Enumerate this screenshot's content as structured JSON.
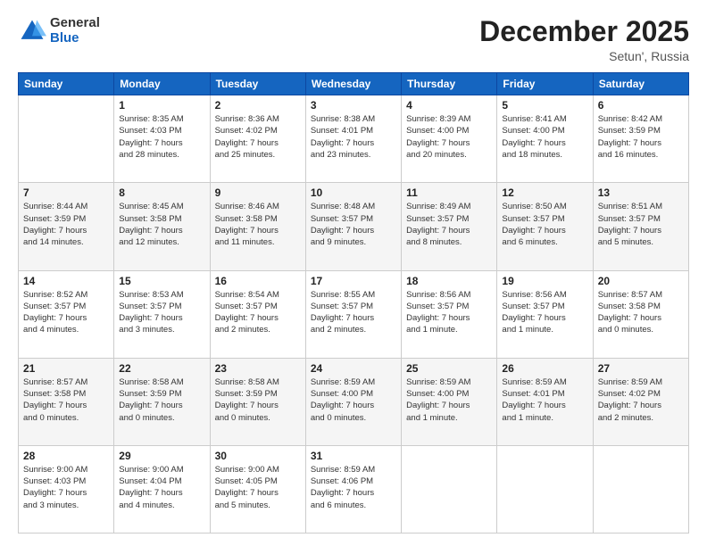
{
  "logo": {
    "general": "General",
    "blue": "Blue"
  },
  "title": "December 2025",
  "subtitle": "Setun', Russia",
  "days": [
    "Sunday",
    "Monday",
    "Tuesday",
    "Wednesday",
    "Thursday",
    "Friday",
    "Saturday"
  ],
  "weeks": [
    [
      {
        "date": "",
        "info": ""
      },
      {
        "date": "1",
        "info": "Sunrise: 8:35 AM\nSunset: 4:03 PM\nDaylight: 7 hours\nand 28 minutes."
      },
      {
        "date": "2",
        "info": "Sunrise: 8:36 AM\nSunset: 4:02 PM\nDaylight: 7 hours\nand 25 minutes."
      },
      {
        "date": "3",
        "info": "Sunrise: 8:38 AM\nSunset: 4:01 PM\nDaylight: 7 hours\nand 23 minutes."
      },
      {
        "date": "4",
        "info": "Sunrise: 8:39 AM\nSunset: 4:00 PM\nDaylight: 7 hours\nand 20 minutes."
      },
      {
        "date": "5",
        "info": "Sunrise: 8:41 AM\nSunset: 4:00 PM\nDaylight: 7 hours\nand 18 minutes."
      },
      {
        "date": "6",
        "info": "Sunrise: 8:42 AM\nSunset: 3:59 PM\nDaylight: 7 hours\nand 16 minutes."
      }
    ],
    [
      {
        "date": "7",
        "info": "Sunrise: 8:44 AM\nSunset: 3:59 PM\nDaylight: 7 hours\nand 14 minutes."
      },
      {
        "date": "8",
        "info": "Sunrise: 8:45 AM\nSunset: 3:58 PM\nDaylight: 7 hours\nand 12 minutes."
      },
      {
        "date": "9",
        "info": "Sunrise: 8:46 AM\nSunset: 3:58 PM\nDaylight: 7 hours\nand 11 minutes."
      },
      {
        "date": "10",
        "info": "Sunrise: 8:48 AM\nSunset: 3:57 PM\nDaylight: 7 hours\nand 9 minutes."
      },
      {
        "date": "11",
        "info": "Sunrise: 8:49 AM\nSunset: 3:57 PM\nDaylight: 7 hours\nand 8 minutes."
      },
      {
        "date": "12",
        "info": "Sunrise: 8:50 AM\nSunset: 3:57 PM\nDaylight: 7 hours\nand 6 minutes."
      },
      {
        "date": "13",
        "info": "Sunrise: 8:51 AM\nSunset: 3:57 PM\nDaylight: 7 hours\nand 5 minutes."
      }
    ],
    [
      {
        "date": "14",
        "info": "Sunrise: 8:52 AM\nSunset: 3:57 PM\nDaylight: 7 hours\nand 4 minutes."
      },
      {
        "date": "15",
        "info": "Sunrise: 8:53 AM\nSunset: 3:57 PM\nDaylight: 7 hours\nand 3 minutes."
      },
      {
        "date": "16",
        "info": "Sunrise: 8:54 AM\nSunset: 3:57 PM\nDaylight: 7 hours\nand 2 minutes."
      },
      {
        "date": "17",
        "info": "Sunrise: 8:55 AM\nSunset: 3:57 PM\nDaylight: 7 hours\nand 2 minutes."
      },
      {
        "date": "18",
        "info": "Sunrise: 8:56 AM\nSunset: 3:57 PM\nDaylight: 7 hours\nand 1 minute."
      },
      {
        "date": "19",
        "info": "Sunrise: 8:56 AM\nSunset: 3:57 PM\nDaylight: 7 hours\nand 1 minute."
      },
      {
        "date": "20",
        "info": "Sunrise: 8:57 AM\nSunset: 3:58 PM\nDaylight: 7 hours\nand 0 minutes."
      }
    ],
    [
      {
        "date": "21",
        "info": "Sunrise: 8:57 AM\nSunset: 3:58 PM\nDaylight: 7 hours\nand 0 minutes."
      },
      {
        "date": "22",
        "info": "Sunrise: 8:58 AM\nSunset: 3:59 PM\nDaylight: 7 hours\nand 0 minutes."
      },
      {
        "date": "23",
        "info": "Sunrise: 8:58 AM\nSunset: 3:59 PM\nDaylight: 7 hours\nand 0 minutes."
      },
      {
        "date": "24",
        "info": "Sunrise: 8:59 AM\nSunset: 4:00 PM\nDaylight: 7 hours\nand 0 minutes."
      },
      {
        "date": "25",
        "info": "Sunrise: 8:59 AM\nSunset: 4:00 PM\nDaylight: 7 hours\nand 1 minute."
      },
      {
        "date": "26",
        "info": "Sunrise: 8:59 AM\nSunset: 4:01 PM\nDaylight: 7 hours\nand 1 minute."
      },
      {
        "date": "27",
        "info": "Sunrise: 8:59 AM\nSunset: 4:02 PM\nDaylight: 7 hours\nand 2 minutes."
      }
    ],
    [
      {
        "date": "28",
        "info": "Sunrise: 9:00 AM\nSunset: 4:03 PM\nDaylight: 7 hours\nand 3 minutes."
      },
      {
        "date": "29",
        "info": "Sunrise: 9:00 AM\nSunset: 4:04 PM\nDaylight: 7 hours\nand 4 minutes."
      },
      {
        "date": "30",
        "info": "Sunrise: 9:00 AM\nSunset: 4:05 PM\nDaylight: 7 hours\nand 5 minutes."
      },
      {
        "date": "31",
        "info": "Sunrise: 8:59 AM\nSunset: 4:06 PM\nDaylight: 7 hours\nand 6 minutes."
      },
      {
        "date": "",
        "info": ""
      },
      {
        "date": "",
        "info": ""
      },
      {
        "date": "",
        "info": ""
      }
    ]
  ]
}
